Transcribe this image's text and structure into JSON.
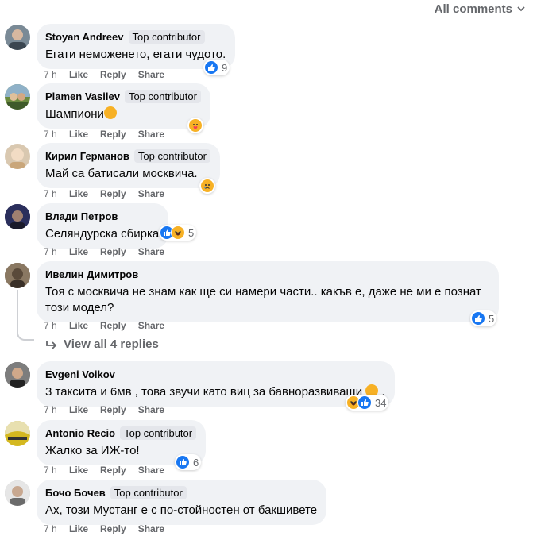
{
  "sort": {
    "label": "All comments"
  },
  "comments": [
    {
      "author": "Stoyan Andreev",
      "badge": "Top contributor",
      "text": "Егати неможенето, егати чудото.",
      "time": "7 h",
      "like": "Like",
      "reply": "Reply",
      "share": "Share",
      "reactions": [
        "like"
      ],
      "count": "9",
      "avatar_color": "#7a8a96"
    },
    {
      "author": "Plamen Vasilev",
      "badge": "Top contributor",
      "text": "Шампиони",
      "time": "7 h",
      "like": "Like",
      "reply": "Reply",
      "share": "Share",
      "reactions": [
        "care"
      ],
      "count": "",
      "avatar_color": "#6b8a3f"
    },
    {
      "author": "Кирил Германов",
      "badge": "Top contributor",
      "text": "Май са батисали москвича.",
      "time": "7 h",
      "like": "Like",
      "reply": "Reply",
      "share": "Share",
      "reactions": [
        "sad"
      ],
      "count": "",
      "avatar_color": "#d9c8b0"
    },
    {
      "author": "Влади Петров",
      "badge": "",
      "text": "Селяндурска сбирка",
      "time": "7 h",
      "like": "Like",
      "reply": "Reply",
      "share": "Share",
      "reactions": [
        "like",
        "haha"
      ],
      "count": "5",
      "avatar_color": "#4a3f6b"
    },
    {
      "author": "Ивелин Димитров",
      "badge": "",
      "text": "Тоя с москвича не знам как ще си намери части.. какъв е, даже не ми е познат този модел?",
      "time": "7 h",
      "like": "Like",
      "reply": "Reply",
      "share": "Share",
      "reactions": [
        "like"
      ],
      "count": "5",
      "avatar_color": "#6a5a48"
    },
    {
      "author": "Evgeni Voikov",
      "badge": "",
      "text": "3 таксита и 6мв , това звучи като виц за бавноразвиващи",
      "time": "7 h",
      "like": "Like",
      "reply": "Reply",
      "share": "Share",
      "reactions": [
        "haha",
        "like"
      ],
      "count": "34",
      "avatar_color": "#5c5c5c"
    },
    {
      "author": "Antonio Recio",
      "badge": "Top contributor",
      "text": "Жалко за ИЖ-то!",
      "time": "7 h",
      "like": "Like",
      "reply": "Reply",
      "share": "Share",
      "reactions": [
        "like"
      ],
      "count": "6",
      "avatar_color": "#c9b23a"
    },
    {
      "author": "Бочо Бочев",
      "badge": "Top contributor",
      "text": "Ах, този Мустанг е с по-стойностен от бакшивете",
      "time": "7 h",
      "like": "Like",
      "reply": "Reply",
      "share": "Share",
      "reactions": [],
      "count": "",
      "avatar_color": "#b8b8b8"
    }
  ],
  "view_replies": {
    "label": "View all 4 replies"
  },
  "colors": {
    "like": "#1877f2",
    "emoji": "#f7b125",
    "bubble": "#f0f2f5",
    "meta": "#65676b"
  },
  "icons": {
    "sort": "chevron-down-icon",
    "reply_arrow": "reply-arrow-icon",
    "like": "like-icon",
    "haha": "haha-icon",
    "sad": "sad-icon",
    "care": "care-icon"
  }
}
